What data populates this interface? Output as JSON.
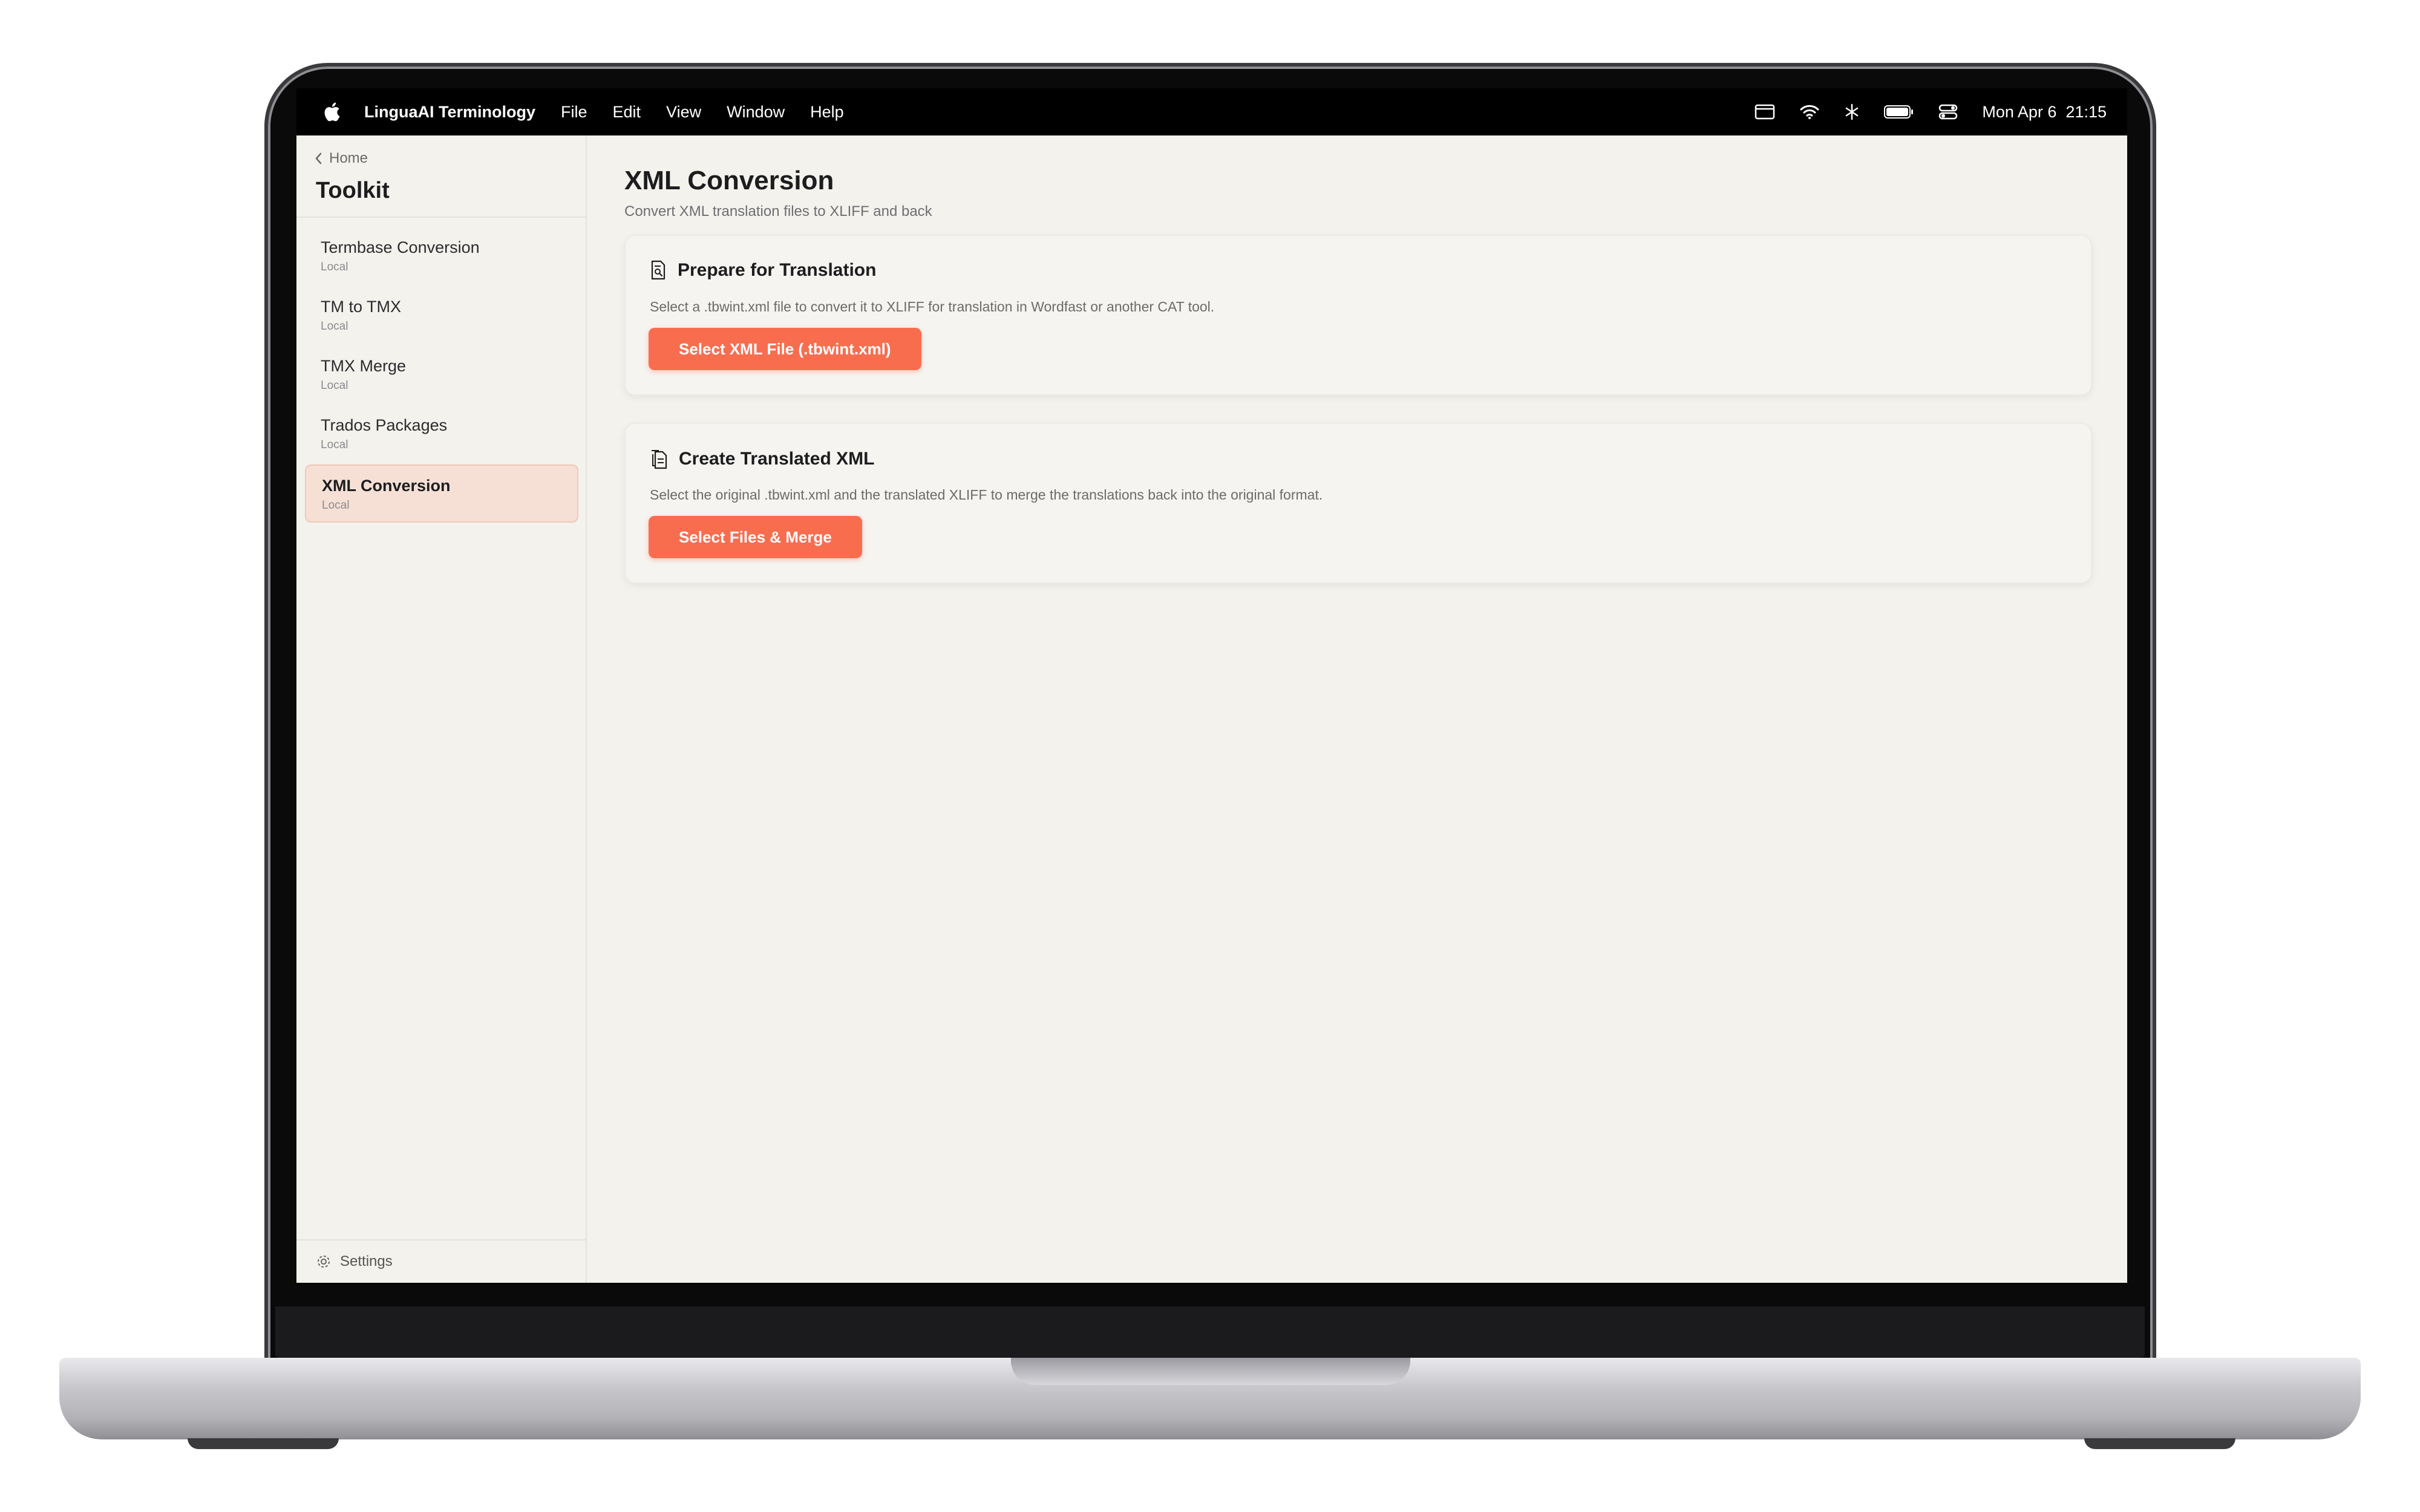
{
  "menubar": {
    "app_name": "LinguaAI Terminology",
    "menus": [
      "File",
      "Edit",
      "View",
      "Window",
      "Help"
    ],
    "date": "Mon Apr 6",
    "time": "21:15"
  },
  "sidebar": {
    "back_label": "Home",
    "title": "Toolkit",
    "items": [
      {
        "label": "Termbase Conversion",
        "sub": "Local"
      },
      {
        "label": "TM to TMX",
        "sub": "Local"
      },
      {
        "label": "TMX Merge",
        "sub": "Local"
      },
      {
        "label": "Trados Packages",
        "sub": "Local"
      },
      {
        "label": "XML Conversion",
        "sub": "Local"
      }
    ],
    "active_index": 4,
    "settings_label": "Settings"
  },
  "main": {
    "title": "XML Conversion",
    "subtitle": "Convert XML translation files to XLIFF and back",
    "cards": [
      {
        "icon": "document-search-icon",
        "title": "Prepare for Translation",
        "description": "Select a .tbwint.xml file to convert it to XLIFF for translation in Wordfast or another CAT tool.",
        "button": "Select XML File (.tbwint.xml)"
      },
      {
        "icon": "documents-icon",
        "title": "Create Translated XML",
        "description": "Select the original .tbwint.xml and the translated XLIFF to merge the translations back into the original format.",
        "button": "Select Files & Merge"
      }
    ]
  },
  "colors": {
    "accent": "#f96d4f",
    "active_item_bg": "#f6e0d6",
    "background": "#f3f2ed"
  }
}
